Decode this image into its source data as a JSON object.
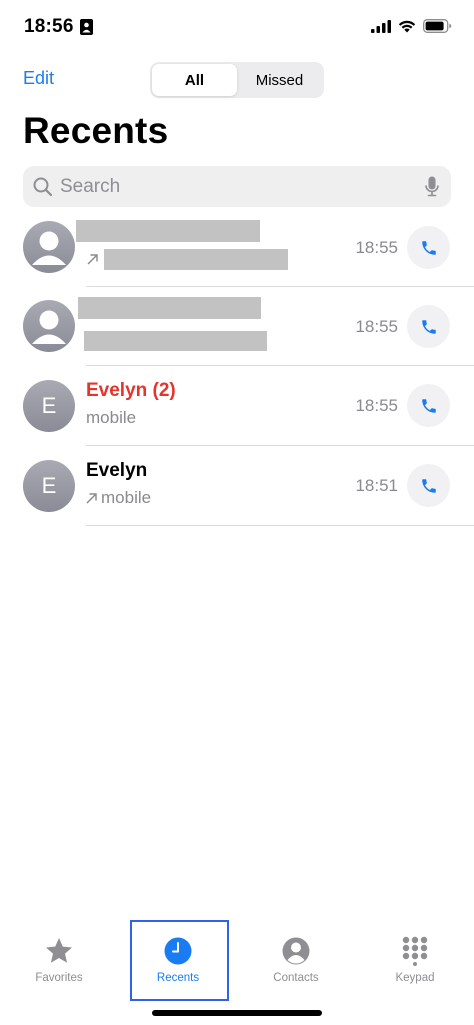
{
  "status": {
    "time": "18:56"
  },
  "header": {
    "edit": "Edit",
    "segments": [
      "All",
      "Missed"
    ],
    "title": "Recents"
  },
  "search": {
    "placeholder": "Search"
  },
  "calls": [
    {
      "name": "",
      "subtitle": "",
      "time": "18:55",
      "missed": false,
      "outgoing": true
    },
    {
      "name": "",
      "subtitle": "",
      "time": "18:55",
      "missed": true,
      "outgoing": false
    },
    {
      "name": "Evelyn (2)",
      "subtitle": "mobile",
      "time": "18:55",
      "initial": "E",
      "missed": true,
      "outgoing": false
    },
    {
      "name": "Evelyn",
      "subtitle": "mobile",
      "time": "18:51",
      "initial": "E",
      "missed": false,
      "outgoing": true
    }
  ],
  "tabs": [
    {
      "label": "Favorites",
      "icon": "star-icon"
    },
    {
      "label": "Recents",
      "icon": "clock-icon",
      "active": true
    },
    {
      "label": "Contacts",
      "icon": "person-circle-icon"
    },
    {
      "label": "Keypad",
      "icon": "keypad-icon"
    }
  ],
  "colors": {
    "accent": "#1a7cf2",
    "missed": "#e5342b",
    "secondary_text": "#8a8a8e"
  }
}
